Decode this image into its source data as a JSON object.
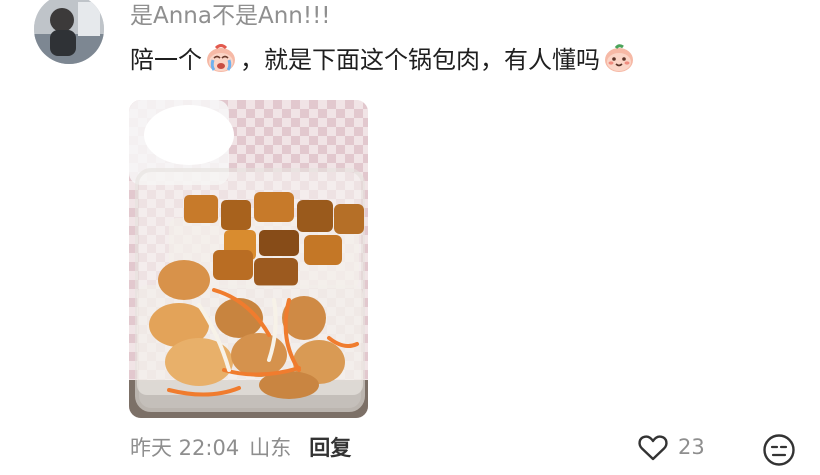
{
  "comment": {
    "username": "是Anna不是Ann!!!",
    "text_part1": "陪一个",
    "text_part2": "，就是下面这个锅包肉，有人懂吗",
    "emojis": [
      "crying-face-emoji",
      "smiling-peach-emoji"
    ],
    "photo_alt": "food-container-photo",
    "meta": {
      "time": "昨天 22:04",
      "location": "山东",
      "reply_label": "回复"
    },
    "likes": {
      "count": "23",
      "icon": "heart-outline-icon"
    },
    "dislike_icon": "neutral-face-icon"
  },
  "colors": {
    "username": "#8f8f8f",
    "text": "#1f1f1f",
    "meta": "#8e8e8e",
    "reply": "#333333"
  }
}
